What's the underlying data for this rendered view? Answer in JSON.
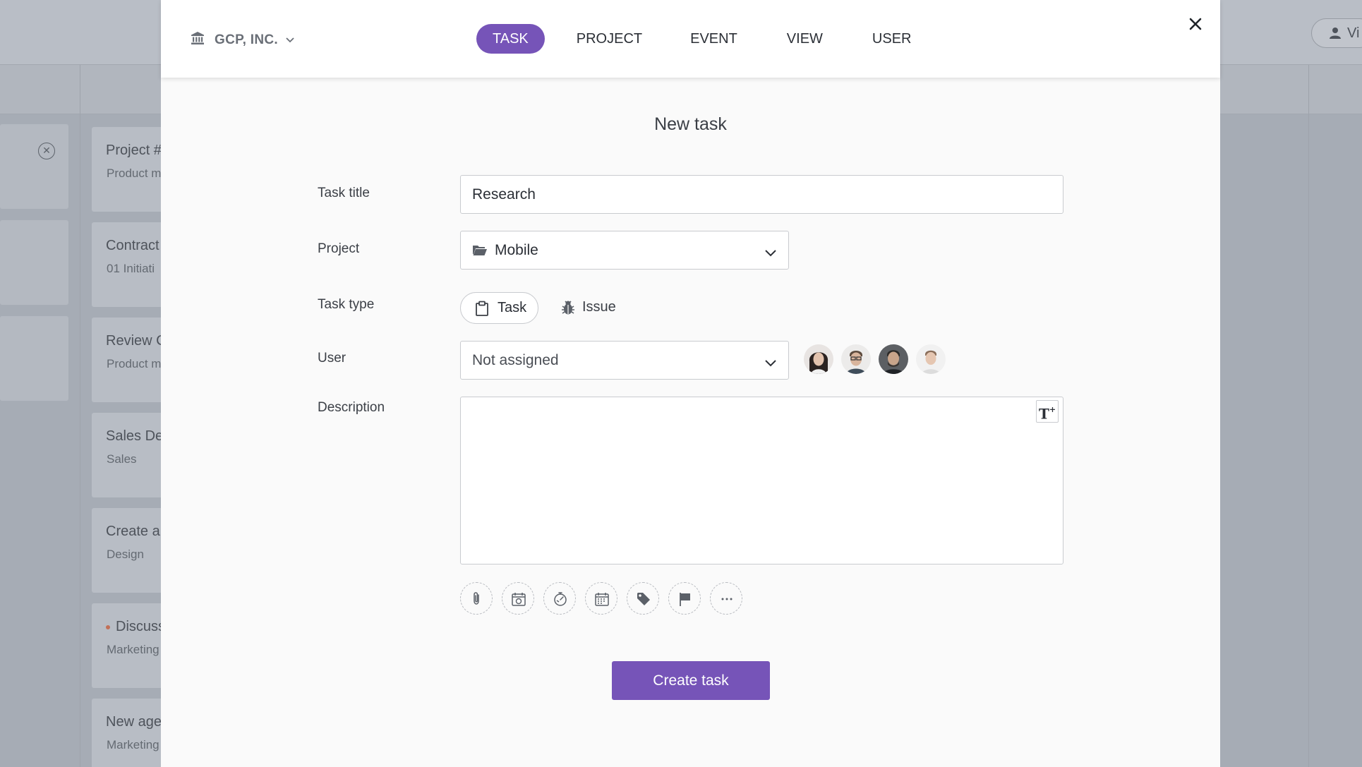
{
  "background": {
    "view_button_label": "Vi",
    "cards": [
      {
        "title": "Project #",
        "subtitle": "Product m"
      },
      {
        "title": "Contract",
        "subtitle": "01 Initiati"
      },
      {
        "title": "Review C",
        "subtitle": "Product m"
      },
      {
        "title": "Sales De",
        "subtitle": "Sales"
      },
      {
        "title": "Create a",
        "subtitle": "Design"
      },
      {
        "title": "Discuss",
        "subtitle": "Marketing"
      },
      {
        "title": "New age",
        "subtitle": "Marketing"
      }
    ]
  },
  "header": {
    "org_name": "GCP, INC.",
    "tabs": [
      {
        "label": "TASK",
        "active": true
      },
      {
        "label": "PROJECT",
        "active": false
      },
      {
        "label": "EVENT",
        "active": false
      },
      {
        "label": "VIEW",
        "active": false
      },
      {
        "label": "USER",
        "active": false
      }
    ]
  },
  "form": {
    "title": "New task",
    "task_title": {
      "label": "Task title",
      "value": "Research"
    },
    "project": {
      "label": "Project",
      "value": "Mobile",
      "icon": "folder-icon"
    },
    "task_type": {
      "label": "Task type",
      "options": [
        {
          "label": "Task",
          "icon": "clipboard-icon",
          "selected": true
        },
        {
          "label": "Issue",
          "icon": "bug-icon",
          "selected": false
        }
      ]
    },
    "user": {
      "label": "User",
      "value": "Not assigned"
    },
    "description": {
      "label": "Description",
      "value": "",
      "format_button": "T"
    },
    "toolbar": [
      "paperclip-icon",
      "calendar-repeat-icon",
      "stopwatch-icon",
      "calendar-icon",
      "tag-icon",
      "flag-icon",
      "more-icon"
    ],
    "submit_label": "Create task"
  },
  "colors": {
    "accent": "#7654b8",
    "overlay": "#a6acb5",
    "modal_bg": "#fafafa"
  }
}
